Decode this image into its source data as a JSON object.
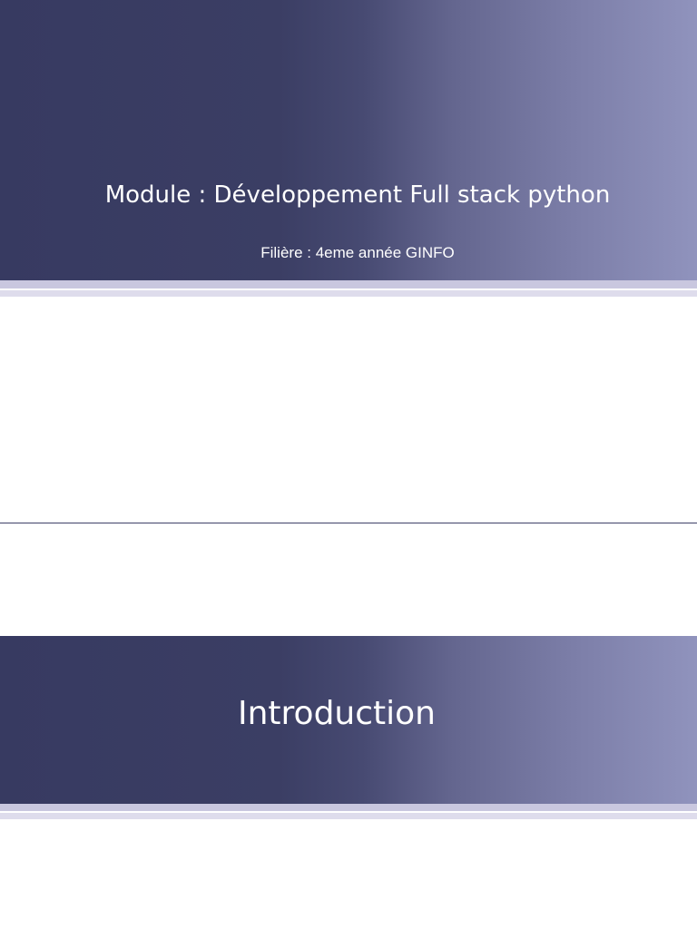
{
  "slide1": {
    "title": "Module : Développement Full stack python",
    "subtitle": "Filière : 4eme année GINFO"
  },
  "slide2": {
    "title": "Introduction"
  },
  "colors": {
    "banner_dark": "#373a61",
    "banner_light": "#9093bd",
    "stripe": "#d6d4e6",
    "divider": "#3e4068"
  }
}
